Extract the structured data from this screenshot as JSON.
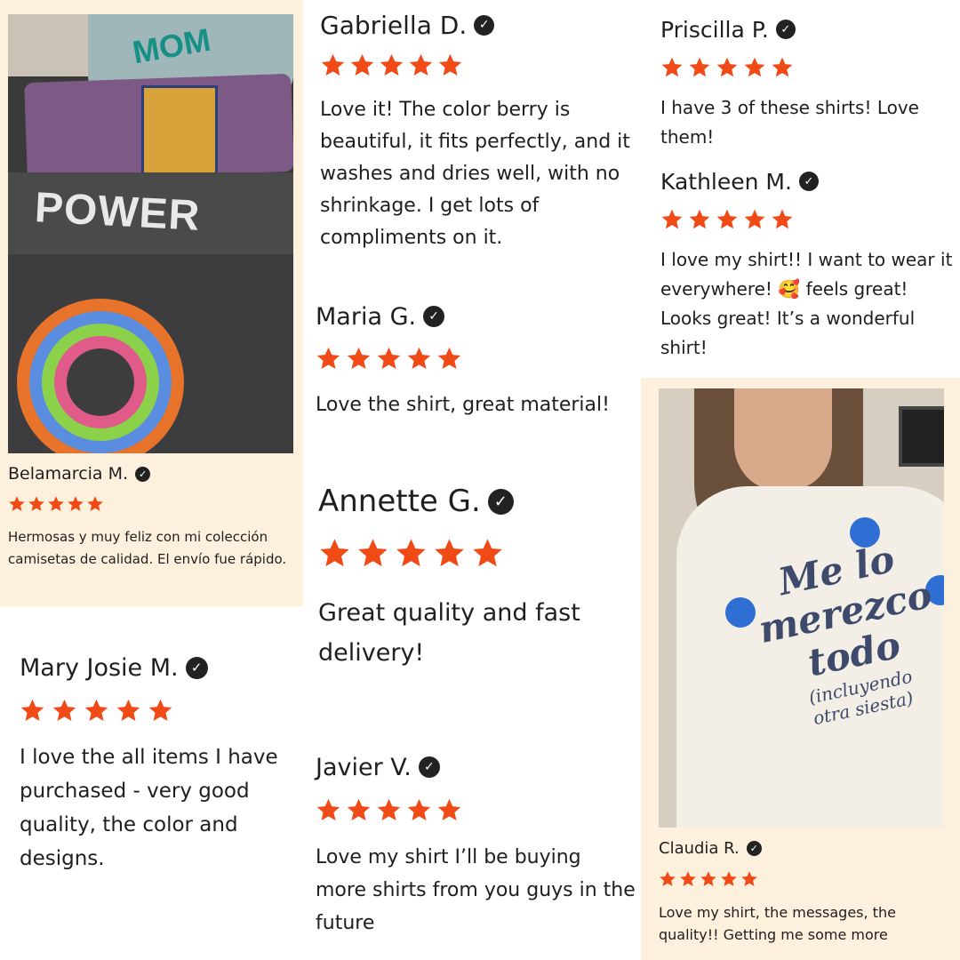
{
  "reviews": [
    {
      "name": "Belamarcia M.",
      "stars": 5,
      "text": "Hermosas y muy feliz con mi colección camisetas de calidad. El envío fue rápido."
    },
    {
      "name": "Gabriella D.",
      "stars": 5,
      "text": "Love it! The color berry is beautiful, it fits perfectly, and it washes and dries well, with no shrinkage. I get lots of compliments on it."
    },
    {
      "name": "Priscilla P.",
      "stars": 5,
      "text": "I have 3 of these shirts! Love them!"
    },
    {
      "name": "Kathleen M.",
      "stars": 5,
      "text": "I love my shirt!! I want to wear it everywhere! 🥰 feels great! Looks great! It’s a wonderful shirt!"
    },
    {
      "name": "Maria G.",
      "stars": 5,
      "text": "Love the shirt, great material!"
    },
    {
      "name": "Annette G.",
      "stars": 5,
      "text": "Great quality and fast delivery!"
    },
    {
      "name": "Mary Josie M.",
      "stars": 5,
      "text": "I love the all items I have purchased - very good quality, the color and designs."
    },
    {
      "name": "Javier V.",
      "stars": 5,
      "text": "Love my shirt I’ll be buying more shirts from you guys in the future"
    },
    {
      "name": "Claudia R.",
      "stars": 5,
      "text": "Love my shirt, the messages, the quality!! Getting me some more"
    }
  ],
  "photo1": {
    "print_power": "POWER",
    "print_mom": "MOM"
  },
  "photo7": {
    "print_main": "Me lo merezco todo",
    "print_sub": "(incluyendo otra siesta)"
  },
  "colors": {
    "star": "#f04a17",
    "card_bg": "#fdf1dd",
    "verified_badge": "#222222"
  }
}
